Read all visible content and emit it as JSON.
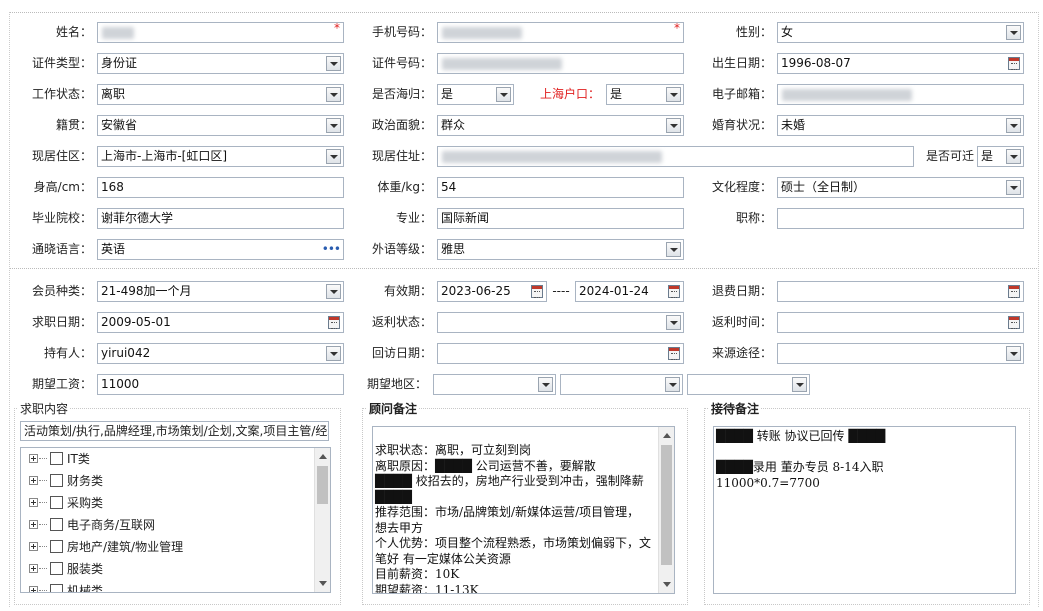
{
  "form": {
    "name": {
      "label": "姓名：",
      "required": "*"
    },
    "phone": {
      "label": "手机号码：",
      "required": "*"
    },
    "gender": {
      "label": "性别：",
      "value": "女"
    },
    "id_type": {
      "label": "证件类型：",
      "value": "身份证"
    },
    "id_number": {
      "label": "证件号码："
    },
    "birth": {
      "label": "出生日期：",
      "value": "1996-08-07"
    },
    "work_status": {
      "label": "工作状态：",
      "value": "离职"
    },
    "returnee": {
      "label": "是否海归：",
      "value": "是"
    },
    "shanghai_hukou": {
      "label": "上海户口：",
      "value": "是"
    },
    "email": {
      "label": "电子邮箱："
    },
    "native_place": {
      "label": "籍贯：",
      "value": "安徽省"
    },
    "political": {
      "label": "政治面貌：",
      "value": "群众"
    },
    "marital": {
      "label": "婚育状况：",
      "value": "未婚"
    },
    "current_area": {
      "label": "现居住区：",
      "value": "上海市-上海市-[虹口区]"
    },
    "current_address": {
      "label": "现居住址："
    },
    "relocate": {
      "label": "是否可迁",
      "value": "是"
    },
    "height": {
      "label": "身高/cm：",
      "value": "168"
    },
    "weight": {
      "label": "体重/kg：",
      "value": "54"
    },
    "education": {
      "label": "文化程度：",
      "value": "硕士（全日制）"
    },
    "school": {
      "label": "毕业院校：",
      "value": "谢菲尔德大学"
    },
    "major": {
      "label": "专业：",
      "value": "国际新闻"
    },
    "title": {
      "label": "职称：",
      "value": ""
    },
    "language": {
      "label": "通晓语言：",
      "value": "英语",
      "more": "•••"
    },
    "lang_level": {
      "label": "外语等级：",
      "value": "雅思"
    }
  },
  "membership": {
    "type": {
      "label": "会员种类：",
      "value": "21-498加一个月"
    },
    "validity": {
      "label": "有效期：",
      "start": "2023-06-25",
      "separator": "----",
      "end": "2024-01-24"
    },
    "refund_date": {
      "label": "退费日期：",
      "value": ""
    },
    "job_date": {
      "label": "求职日期：",
      "value": "2009-05-01"
    },
    "rebate_status": {
      "label": "返利状态：",
      "value": ""
    },
    "rebate_time": {
      "label": "返利时间：",
      "value": ""
    },
    "holder": {
      "label": "持有人：",
      "value": "yirui042"
    },
    "visit_date": {
      "label": "回访日期：",
      "value": ""
    },
    "source": {
      "label": "来源途径：",
      "value": ""
    },
    "salary": {
      "label": "期望工资：",
      "value": "11000"
    },
    "area": {
      "label": "期望地区：",
      "values": [
        "",
        "",
        ""
      ]
    }
  },
  "jobs": {
    "title": "求职内容",
    "selected": "活动策划/执行,品牌经理,市场策划/企划,文案,项目主管/经理",
    "categories": [
      "IT类",
      "财务类",
      "采购类",
      "电子商务/互联网",
      "房地产/建筑/物业管理",
      "服装类",
      "机械类"
    ]
  },
  "advisor": {
    "title": "顾问备注",
    "lines": [
      "求职状态：离职，可立刻到岗",
      "离职原因：████ 公司运营不善，要解散",
      "████ 校招去的，房地产行业受到冲击，强制降薪",
      "████",
      "推荐范围：市场/品牌策划/新媒体运营/项目管理，",
      "想去甲方",
      "个人优势：项目整个流程熟悉，市场策划偏弱下，文",
      "笔好 有一定媒体公关资源",
      "目前薪资：10K",
      "期望薪资：11-13K"
    ]
  },
  "reception": {
    "title": "接待备注",
    "lines": [
      "████    转账  协议已回传   ████",
      "",
      "████录用   董办专员    8-14入职",
      "11000*0.7=7700"
    ]
  }
}
